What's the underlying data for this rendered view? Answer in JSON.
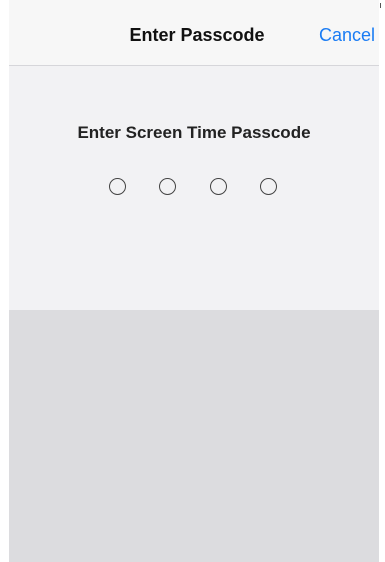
{
  "nav": {
    "title": "Enter Passcode",
    "cancel_label": "Cancel"
  },
  "passcode": {
    "prompt": "Enter Screen Time Passcode",
    "digits_entered": 0,
    "digits_total": 4
  },
  "colors": {
    "accent": "#1a7cf4",
    "background": "#f2f2f4",
    "keyboard_area": "#dcdcdf"
  }
}
